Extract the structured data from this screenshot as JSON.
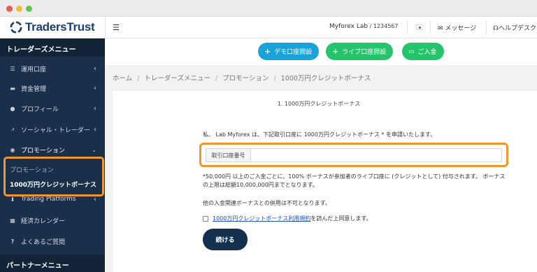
{
  "brand": {
    "name": "TradersTrust"
  },
  "topbar": {
    "account_name": "Myforex Lab",
    "account_number": " / 1234567",
    "messages": "メッセージ",
    "help": "ヘルプデスク"
  },
  "sidebar": {
    "header": "トレーダーズメニュー",
    "items": [
      {
        "label": "運用口座",
        "icon": "list-icon"
      },
      {
        "label": "資金管理",
        "icon": "wallet-icon"
      },
      {
        "label": "プロフィール",
        "icon": "user-icon"
      },
      {
        "label": "ソーシャル・トレーダー",
        "icon": "chart-icon"
      },
      {
        "label": "プロモーション",
        "icon": "globe-icon"
      },
      {
        "label": "Trading Platforms",
        "icon": "download-icon"
      },
      {
        "label": "経済カレンダー",
        "icon": "calendar-icon"
      },
      {
        "label": "よくあるご質問",
        "icon": "question-icon"
      }
    ],
    "partner_header": "パートナーメニュー",
    "popup": {
      "sub_label": "プロモーション",
      "active_label": "1000万円クレジットボーナス"
    }
  },
  "actions": {
    "demo": "デモ口座開設",
    "live": "ライブ口座開設",
    "deposit": "ご入金"
  },
  "breadcrumb": [
    "ホーム",
    "トレーダーズメニュー",
    "プロモーション",
    "1000万円クレジットボーナス"
  ],
  "form": {
    "title": "1. 1000万円クレジットボーナス",
    "apply_text": "私、 Lab Myforex は、下記取引口座に 1000万円クレジットボーナス * を申請いたします。",
    "account_label": "取引口座番号",
    "account_value": "",
    "note1": "*50,000円 以上のご入金ごとに、100% ボーナスが参加者のライブ口座に (クレジットとして) 付与されます。 ボーナスの上限は総額10,000,000円までとなります。",
    "note2": "他の入金関連ボーナスとの併用は不可となります。",
    "terms_link": "1000万円クレジットボーナス利用規約",
    "terms_suffix": "を読んだ上同意します。",
    "agree_checked": false,
    "continue": "続ける"
  },
  "colors": {
    "highlight": "#f0962c",
    "sidebar": "#1a2f4a",
    "demo_button": "#1aa3d8",
    "live_button": "#23c46a",
    "continue_button": "#13304f"
  }
}
